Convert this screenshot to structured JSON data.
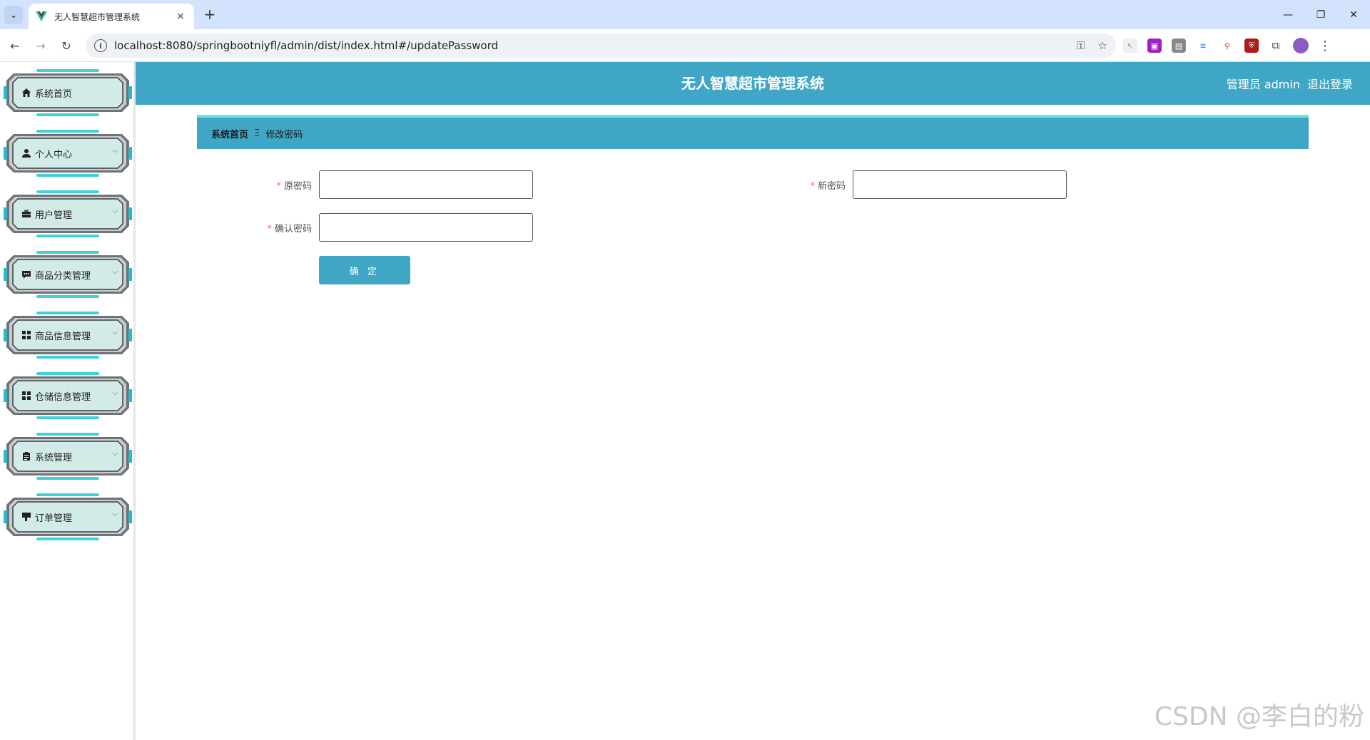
{
  "browser": {
    "tab_title": "无人智慧超市管理系统",
    "url": "localhost:8080/springbootniyfl/admin/dist/index.html#/updatePassword",
    "new_tab": "+",
    "close_tab": "×"
  },
  "app": {
    "title": "无人智慧超市管理系统",
    "user_role": "管理员 admin",
    "logout": "退出登录"
  },
  "sidebar": {
    "items": [
      {
        "label": "系统首页",
        "icon": "home-icon",
        "has_children": false
      },
      {
        "label": "个人中心",
        "icon": "person-icon",
        "has_children": true
      },
      {
        "label": "用户管理",
        "icon": "briefcase-icon",
        "has_children": true
      },
      {
        "label": "商品分类管理",
        "icon": "comment-icon",
        "has_children": true
      },
      {
        "label": "商品信息管理",
        "icon": "grid-icon",
        "has_children": true
      },
      {
        "label": "仓储信息管理",
        "icon": "grid-icon",
        "has_children": true
      },
      {
        "label": "系统管理",
        "icon": "clipboard-icon",
        "has_children": true
      },
      {
        "label": "订单管理",
        "icon": "sign-icon",
        "has_children": true
      }
    ]
  },
  "breadcrumb": {
    "home": "系统首页",
    "separator": "Ξ",
    "current": "修改密码"
  },
  "form": {
    "old_password_label": "原密码",
    "new_password_label": "新密码",
    "confirm_password_label": "确认密码",
    "required_mark": "*",
    "old_password_value": "",
    "new_password_value": "",
    "confirm_password_value": "",
    "submit_label": "确 定"
  },
  "watermark": "CSDN @李白的粉",
  "colors": {
    "header": "#40a6c5",
    "accent": "#6ee0ea",
    "tab_strip": "#d3e3fd"
  }
}
